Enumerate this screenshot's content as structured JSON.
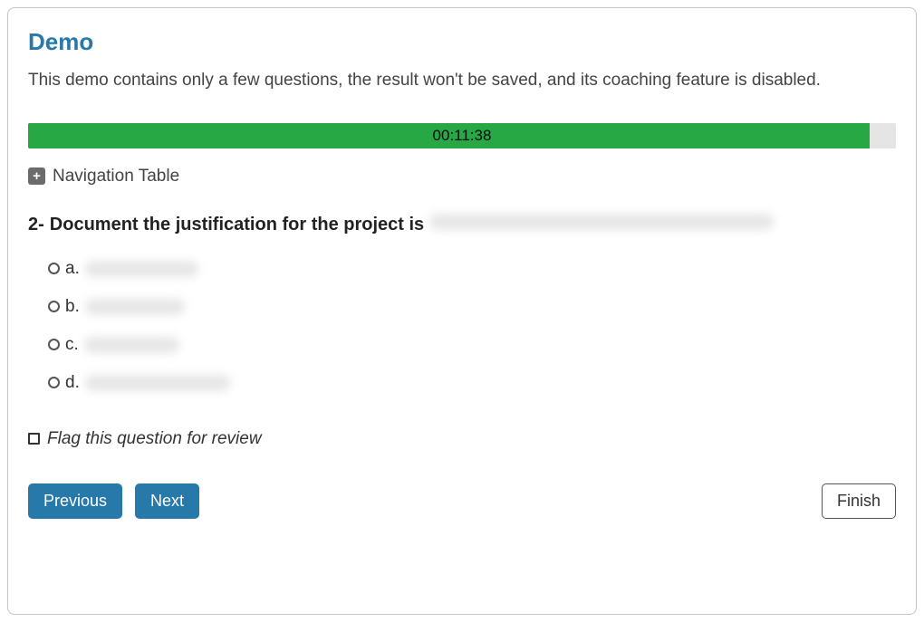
{
  "header": {
    "title": "Demo",
    "subtitle": "This demo contains only a few questions, the result won't be saved, and its coaching feature is disabled."
  },
  "timer": {
    "display": "00:11:38",
    "progress_percent": 97
  },
  "navigation_toggle": {
    "label": "Navigation Table",
    "icon": "plus-icon"
  },
  "question": {
    "number": "2-",
    "text": "Document the justification for the project is",
    "options": [
      {
        "letter": "a."
      },
      {
        "letter": "b."
      },
      {
        "letter": "c."
      },
      {
        "letter": "d."
      }
    ]
  },
  "flag": {
    "label": "Flag this question for review"
  },
  "buttons": {
    "previous": "Previous",
    "next": "Next",
    "finish": "Finish"
  }
}
